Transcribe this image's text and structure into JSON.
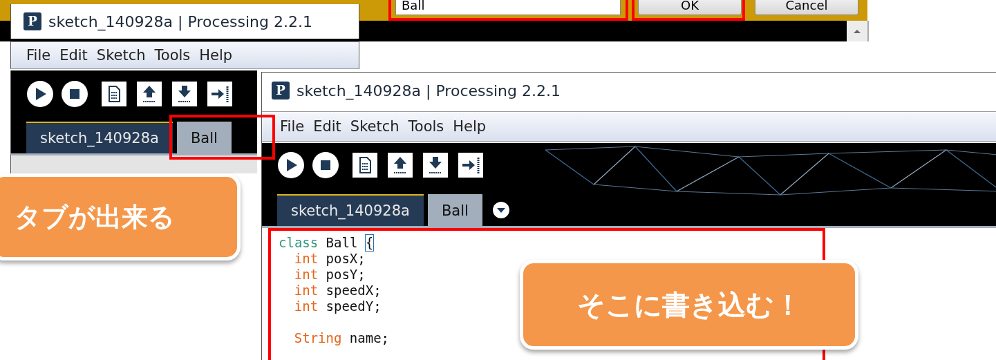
{
  "dialog": {
    "field_value": "Ball",
    "buttons": [
      "OK",
      "Cancel"
    ]
  },
  "windows": [
    {
      "icon_letter": "P",
      "title": "sketch_140928a | Processing 2.2.1",
      "menu": [
        "File",
        "Edit",
        "Sketch",
        "Tools",
        "Help"
      ],
      "tabs": [
        {
          "label": "sketch_140928a",
          "selected": false
        },
        {
          "label": "Ball",
          "selected": true
        }
      ]
    },
    {
      "icon_letter": "P",
      "title": "sketch_140928a | Processing 2.2.1",
      "menu": [
        "File",
        "Edit",
        "Sketch",
        "Tools",
        "Help"
      ],
      "tabs": [
        {
          "label": "sketch_140928a",
          "selected": false
        },
        {
          "label": "Ball",
          "selected": true
        }
      ],
      "code": {
        "header": [
          {
            "kind": "keyword",
            "text": "class"
          },
          {
            "kind": "plain",
            "text": "Ball"
          },
          {
            "kind": "bracket",
            "text": "{"
          }
        ],
        "children": [
          {
            "kind": "line",
            "tokens": [
              {
                "kind": "type",
                "text": "int"
              },
              {
                "kind": "plain",
                "text": "posX;"
              }
            ]
          },
          {
            "kind": "line",
            "tokens": [
              {
                "kind": "type",
                "text": "int"
              },
              {
                "kind": "plain",
                "text": "posY;"
              }
            ]
          },
          {
            "kind": "line",
            "tokens": [
              {
                "kind": "type",
                "text": "int"
              },
              {
                "kind": "plain",
                "text": "speedX;"
              }
            ]
          },
          {
            "kind": "line",
            "tokens": [
              {
                "kind": "type",
                "text": "int"
              },
              {
                "kind": "plain",
                "text": "speedY;"
              }
            ]
          },
          {
            "kind": "blank"
          },
          {
            "kind": "line",
            "tokens": [
              {
                "kind": "type",
                "text": "String"
              },
              {
                "kind": "plain",
                "text": "name;"
              }
            ]
          }
        ]
      }
    }
  ],
  "callouts": [
    {
      "text": "タブが出来る"
    },
    {
      "text": "そこに書き込む！"
    }
  ]
}
